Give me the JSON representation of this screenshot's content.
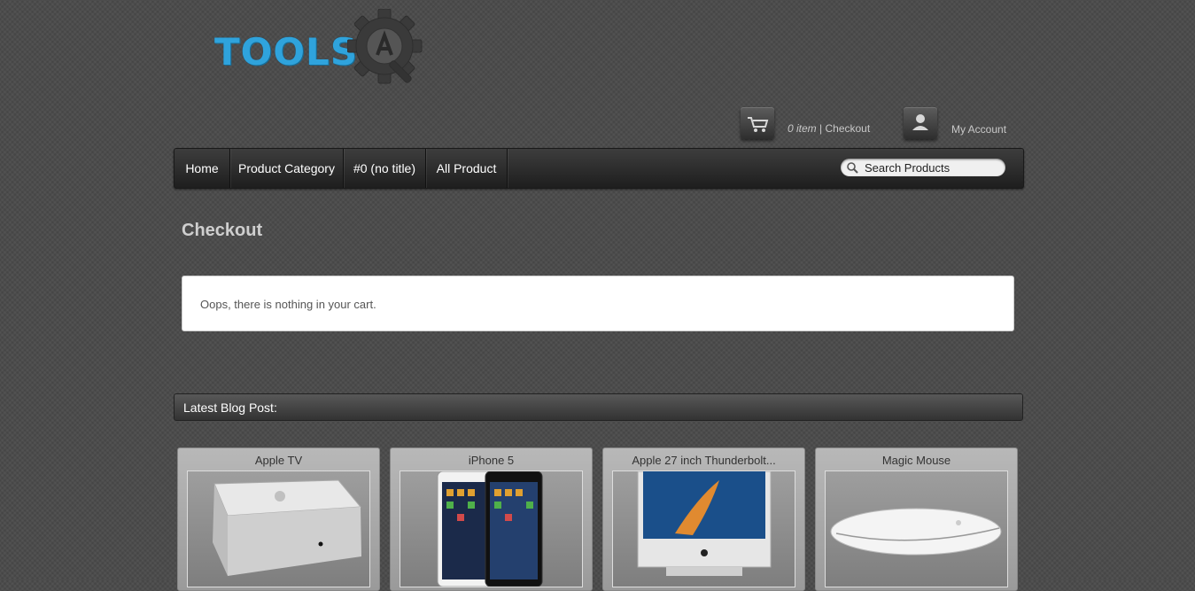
{
  "brand": {
    "logo_text": "TOOLS"
  },
  "header": {
    "cart_count": "0 item",
    "cart_separator": " | ",
    "cart_link": "Checkout",
    "account_link": "My Account"
  },
  "nav": {
    "items": [
      {
        "label": "Home"
      },
      {
        "label": "Product Category"
      },
      {
        "label": "#0 (no title)"
      },
      {
        "label": "All Product"
      }
    ],
    "search_placeholder": "Search Products"
  },
  "main": {
    "title": "Checkout",
    "empty_message": "Oops, there is nothing in your cart."
  },
  "blog": {
    "header": "Latest Blog Post:"
  },
  "products": [
    {
      "name": "Apple TV"
    },
    {
      "name": "iPhone 5"
    },
    {
      "name": "Apple 27 inch Thunderbolt..."
    },
    {
      "name": "Magic Mouse"
    }
  ],
  "colors": {
    "accent": "#2fa3dc",
    "background": "#4a4a4a",
    "nav": "#2b2b2b"
  }
}
